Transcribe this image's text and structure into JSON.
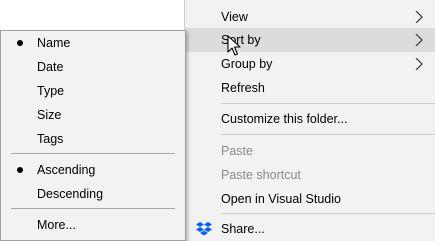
{
  "main_menu": {
    "items": [
      {
        "label": "View",
        "submenu": true
      },
      {
        "label": "Sort by",
        "submenu": true
      },
      {
        "label": "Group by",
        "submenu": true
      },
      {
        "label": "Refresh"
      },
      {
        "label": "Customize this folder..."
      },
      {
        "label": "Paste",
        "disabled": true
      },
      {
        "label": "Paste shortcut",
        "disabled": true
      },
      {
        "label": "Open in Visual Studio"
      },
      {
        "label": "Share...",
        "icon": "dropbox-icon"
      }
    ]
  },
  "sort_submenu": {
    "items": [
      {
        "label": "Name",
        "checked": true
      },
      {
        "label": "Date"
      },
      {
        "label": "Type"
      },
      {
        "label": "Size"
      },
      {
        "label": "Tags"
      },
      {
        "label": "Ascending",
        "checked": true
      },
      {
        "label": "Descending"
      },
      {
        "label": "More..."
      }
    ]
  },
  "colors": {
    "menu_bg": "#f2f2f2",
    "hover_bg": "#dcdcdc",
    "disabled_text": "#8a8a8a",
    "dropbox_blue": "#0061fe"
  }
}
